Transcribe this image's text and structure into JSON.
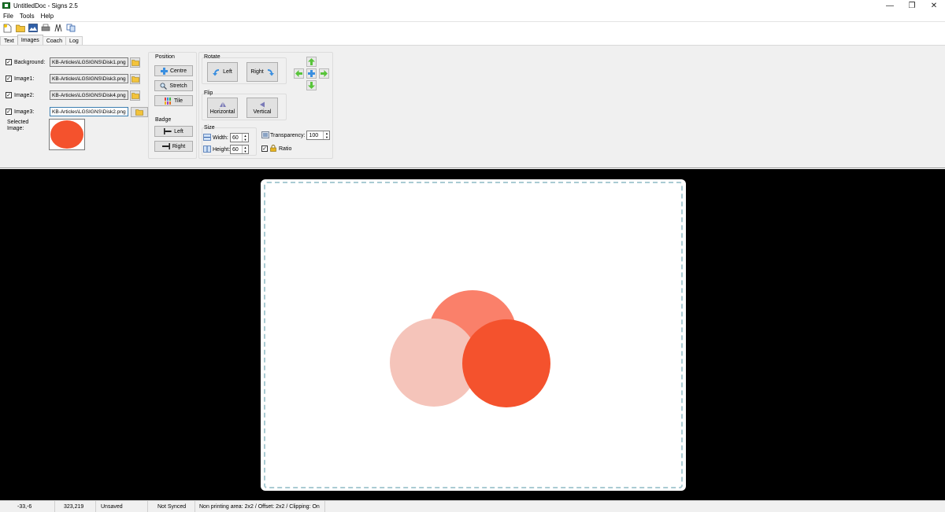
{
  "window": {
    "title": "UntitledDoc - Signs 2.5"
  },
  "menu": {
    "items": [
      "File",
      "Tools",
      "Help"
    ]
  },
  "toolbar": {
    "icons": [
      "new-document-icon",
      "open-folder-icon",
      "picture-icon",
      "print-icon",
      "trim-icon",
      "copy-icon"
    ]
  },
  "tabs": {
    "items": [
      "Text",
      "Images",
      "Coach",
      "Log"
    ],
    "active": "Images"
  },
  "images_panel": {
    "rows": [
      {
        "checked": true,
        "label": "Background:",
        "path": "KB-Articles\\LGSIGNS\\Disk1.png"
      },
      {
        "checked": true,
        "label": "Image1:",
        "path": "KB-Articles\\LGSIGNS\\Disk3.png"
      },
      {
        "checked": true,
        "label": "Image2:",
        "path": "KB-Articles\\LGSIGNS\\Disk4.png"
      },
      {
        "checked": true,
        "label": "Image3:",
        "path": "KB-Articles\\LGSIGNS\\Disk2.png"
      }
    ],
    "selected_label": "Selected Image:",
    "selected_color": "#f4522d"
  },
  "position": {
    "label": "Position",
    "centre": "Centre",
    "stretch": "Stretch",
    "tile": "Tile"
  },
  "badge": {
    "label": "Badge",
    "left": "Left",
    "right": "Right"
  },
  "rotate": {
    "label": "Rotate",
    "left": "Left",
    "right": "Right"
  },
  "flip": {
    "label": "Flip",
    "horizontal": "Horizontal",
    "vertical": "Vertical"
  },
  "size": {
    "label": "Size",
    "width_label": "Width:",
    "width": "60",
    "height_label": "Height:",
    "height": "60"
  },
  "transparency": {
    "label": "Transparency:",
    "value": "100"
  },
  "ratio": {
    "label": "Ratio",
    "checked": true
  },
  "canvas": {
    "colors": {
      "background": "#000000",
      "sign": "#ffffff",
      "dash": "#a9cbd3"
    },
    "disks": [
      {
        "name": "disk-background-coral",
        "color": "#fa806a"
      },
      {
        "name": "disk-image1-pink",
        "color": "#f5c4ba"
      },
      {
        "name": "disk-image3-red",
        "color": "#f4522d"
      }
    ]
  },
  "status": {
    "cursor": "-33,-6",
    "position": "323,219",
    "saved": "Unsaved",
    "sync": "Not Synced",
    "info": "Non printing area: 2x2 / Offset: 2x2 / Clipping: On"
  }
}
